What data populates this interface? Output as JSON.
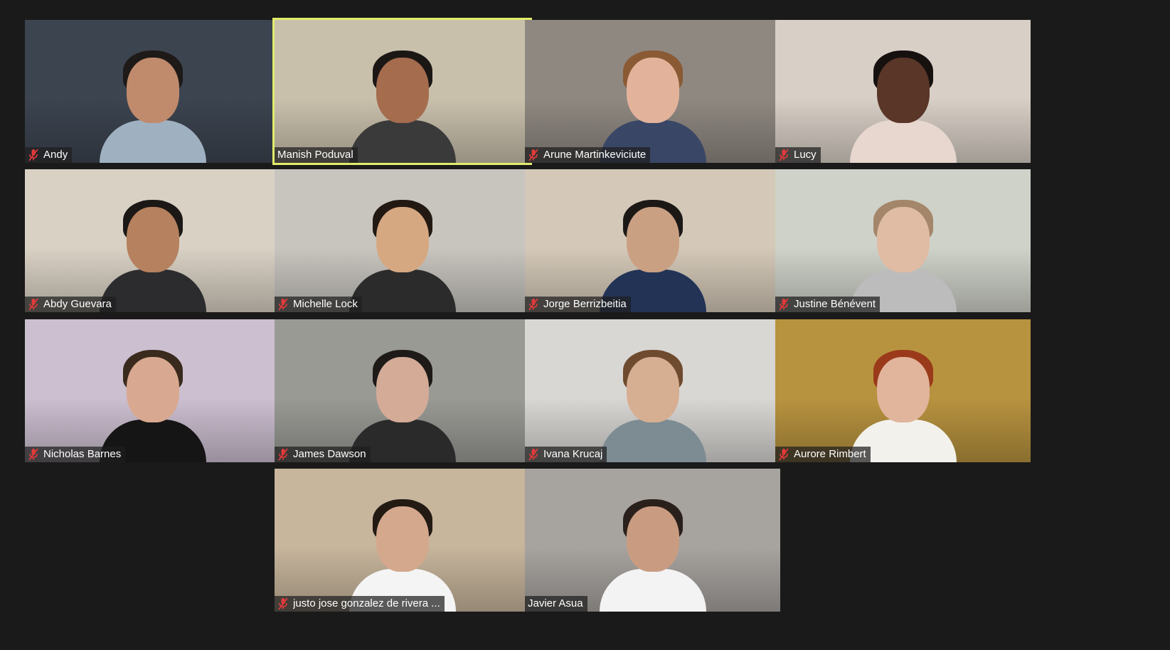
{
  "meeting": {
    "participants": [
      {
        "name": "Andy",
        "muted": true,
        "active": false,
        "bg": "#3c4450",
        "skin": "#c08a6c",
        "hair": "#1e1a18",
        "shirt": "#9fb1c1"
      },
      {
        "name": "Manish Poduval",
        "muted": false,
        "active": true,
        "bg": "#c9c0ac",
        "skin": "#a56c4e",
        "hair": "#1b1715",
        "shirt": "#3b3a3a"
      },
      {
        "name": "Arune Martinkeviciute",
        "muted": true,
        "active": false,
        "bg": "#8f8881",
        "skin": "#e2b39a",
        "hair": "#8a5a34",
        "shirt": "#3a4666"
      },
      {
        "name": "Lucy",
        "muted": true,
        "active": false,
        "bg": "#d8cfc6",
        "skin": "#5a3628",
        "hair": "#16110f",
        "shirt": "#e7d7cf"
      },
      {
        "name": "Abdy Guevara",
        "muted": true,
        "active": false,
        "bg": "#d9d1c4",
        "skin": "#b6815f",
        "hair": "#1c1816",
        "shirt": "#2c2c2e"
      },
      {
        "name": "Michelle Lock",
        "muted": true,
        "active": false,
        "bg": "#c8c5bf",
        "skin": "#d6a882",
        "hair": "#221913",
        "shirt": "#2b2b2b"
      },
      {
        "name": "Jorge Berrizbeitia",
        "muted": true,
        "active": false,
        "bg": "#d4c9b8",
        "skin": "#caa083",
        "hair": "#1c1816",
        "shirt": "#223356"
      },
      {
        "name": "Justine Bénévent",
        "muted": true,
        "active": false,
        "bg": "#cfd2c9",
        "skin": "#e0bca5",
        "hair": "#a4866a",
        "shirt": "#bcbcbc"
      },
      {
        "name": "Nicholas Barnes",
        "muted": true,
        "active": false,
        "bg": "#ccbfd0",
        "skin": "#d8a890",
        "hair": "#3a2a1e",
        "shirt": "#151515"
      },
      {
        "name": "James Dawson",
        "muted": true,
        "active": false,
        "bg": "#9a9a95",
        "skin": "#d3ab97",
        "hair": "#1d1a18",
        "shirt": "#2a2a2a"
      },
      {
        "name": "Ivana Krucaj",
        "muted": true,
        "active": false,
        "bg": "#d9d7d4",
        "skin": "#d6ae92",
        "hair": "#6e4a2e",
        "shirt": "#7d8b92"
      },
      {
        "name": "Aurore Rimbert",
        "muted": true,
        "active": false,
        "bg": "#b8933f",
        "skin": "#e1b49c",
        "hair": "#9a3a1a",
        "shirt": "#f3f1ec"
      },
      {
        "name": "justo jose gonzalez de rivera ...",
        "muted": true,
        "active": false,
        "bg": "#c7b59c",
        "skin": "#d4a88d",
        "hair": "#231a14",
        "shirt": "#f4f4f4"
      },
      {
        "name": "Javier Asua",
        "muted": false,
        "active": false,
        "bg": "#a7a39f",
        "skin": "#c99c82",
        "hair": "#2a201b",
        "shirt": "#f3f3f3"
      }
    ]
  }
}
